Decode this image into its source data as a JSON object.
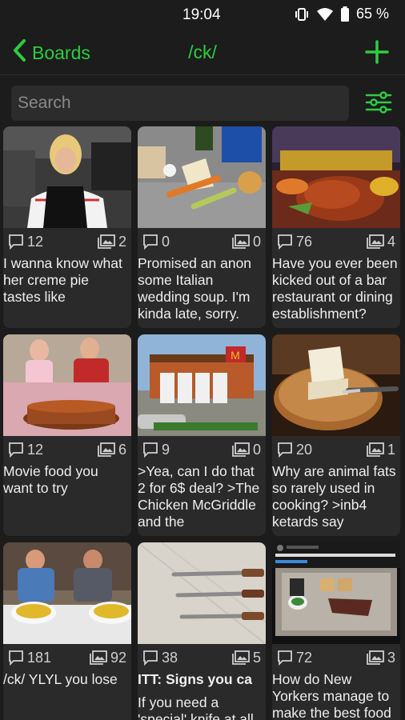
{
  "status": {
    "time": "19:04",
    "battery": "65 %"
  },
  "toolbar": {
    "back_label": "Boards",
    "board": "/ck/"
  },
  "search": {
    "placeholder": "Search"
  },
  "colors": {
    "accent": "#2ecc40",
    "background": "#1c1c1c",
    "card": "#2a2a2a"
  },
  "threads": [
    {
      "replies": "12",
      "images": "2",
      "subject": "",
      "text": "I wanna know what her creme pie tastes like"
    },
    {
      "replies": "0",
      "images": "0",
      "subject": "",
      "text": "Promised an anon some Italian wedding soup. I'm kinda late, sorry."
    },
    {
      "replies": "76",
      "images": "4",
      "subject": "",
      "text": "Have you ever been kicked out of a bar restaurant or dining establishment?"
    },
    {
      "replies": "12",
      "images": "6",
      "subject": "",
      "text": "Movie food you want to try"
    },
    {
      "replies": "9",
      "images": "0",
      "subject": "",
      "text": ">Yea, can I do that 2 for 6$ deal? >The Chicken McGriddle and the"
    },
    {
      "replies": "20",
      "images": "1",
      "subject": "",
      "text": "Why are animal fats so rarely used in cooking? >inb4 ketards say"
    },
    {
      "replies": "181",
      "images": "92",
      "subject": "",
      "text": "/ck/ YLYL you lose"
    },
    {
      "replies": "38",
      "images": "5",
      "subject": "ITT: Signs you ca",
      "text": "If you need a 'special' knife at all you're a"
    },
    {
      "replies": "72",
      "images": "3",
      "subject": "",
      "text": "How do New Yorkers manage to make the best food from"
    }
  ]
}
